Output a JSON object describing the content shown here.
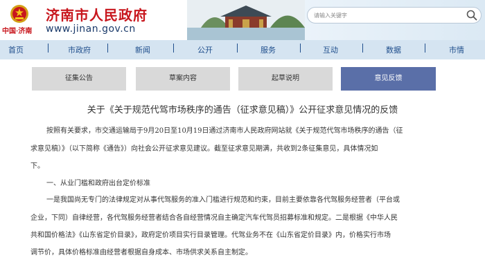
{
  "header": {
    "site_title": "济南市人民政府",
    "site_url": "www.jinan.gov.cn",
    "city_logo_text": "中国·济南",
    "search_placeholder": "请输入关键字"
  },
  "nav": {
    "items": [
      "首页",
      "市政府",
      "新闻",
      "公开",
      "服务",
      "互动",
      "数据",
      "市情"
    ]
  },
  "tabs": [
    {
      "label": "征集公告",
      "active": false
    },
    {
      "label": "草案内容",
      "active": false
    },
    {
      "label": "起草说明",
      "active": false
    },
    {
      "label": "意见反馈",
      "active": true
    }
  ],
  "article": {
    "title": "关于《关于规范代驾市场秩序的通告（征求意见稿）》公开征求意见情况的反馈",
    "lines": [
      "按照有关要求，市交通运输局于9月20日至10月19日通过济南市人民政府网站就《关于规范代驾市场秩序的通告（征",
      "求意见稿）》（以下简称《通告》）向社会公开征求意见建议。截至征求意见期满，共收到2条征集意见，具体情况如",
      "下。",
      "一、从业门槛和政府出台定价标准",
      "一是我国尚无专门的法律规定对从事代驾服务的准入门槛进行规范和约束，目前主要依靠各代驾服务经营者（平台或",
      "企业，下同）自律经营，各代驾服务经营者结合各自经营情况自主确定汽车代驾员招募标准和规定。二是根据《中华人民",
      "共和国价格法》《山东省定价目录》，政府定价项目实行目录管理。代驾业务不在《山东省定价目录》内，价格实行市场",
      "调节价，具体价格标准由经营者根据自身成本、市场供求关系自主制定。"
    ]
  },
  "colors": {
    "brand_red": "#c8161d",
    "nav_bg": "#d5e4f1",
    "nav_text": "#1f4e8c",
    "tab_bg": "#d9d9d9",
    "tab_active_bg": "#5a6fa8"
  }
}
